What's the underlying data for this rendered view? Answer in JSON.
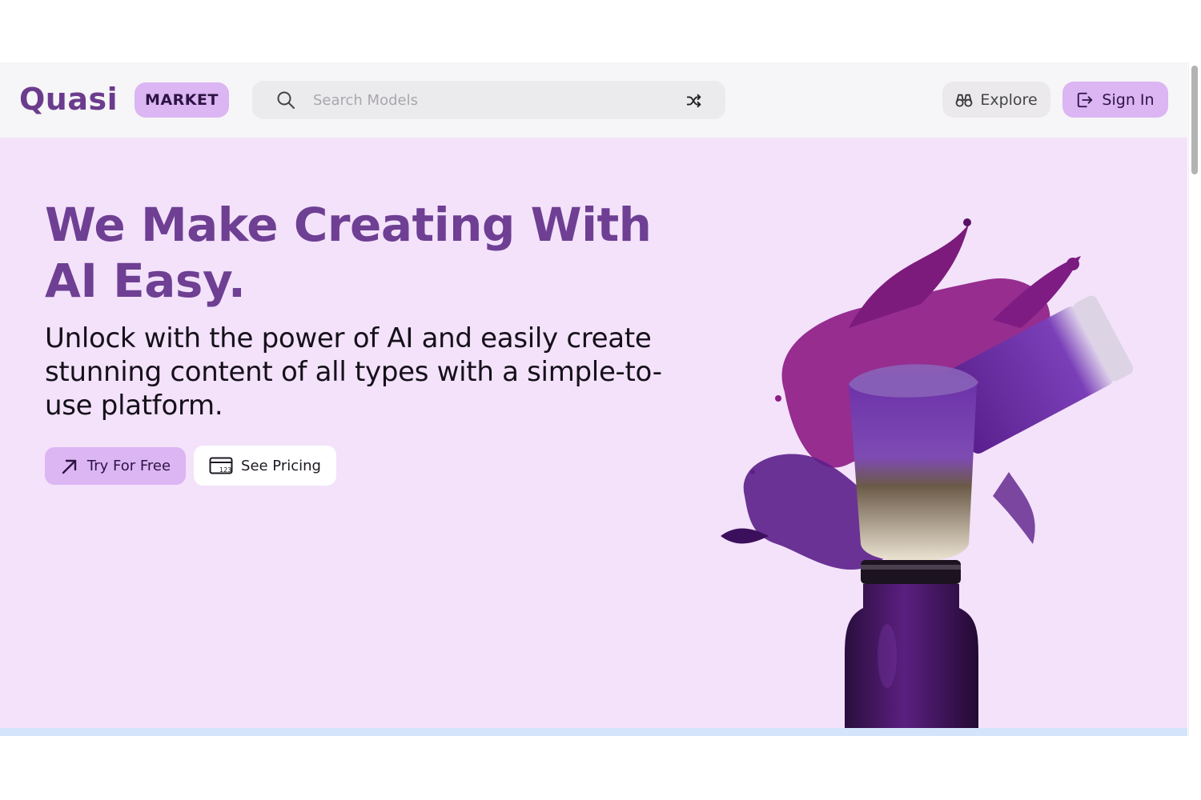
{
  "header": {
    "logo_text": "Quasi",
    "badge_label": "MARKET",
    "search": {
      "placeholder": "Search Models",
      "value": ""
    },
    "explore_label": "Explore",
    "signin_label": "Sign In"
  },
  "hero": {
    "title": "We Make Creating With AI Easy.",
    "subtitle": "Unlock with the power of AI and easily create stunning content of all types with a simple-to-use platform.",
    "primary_cta_label": "Try For Free",
    "secondary_cta_label": "See Pricing",
    "pricing_icon_text": "123"
  },
  "icons": {
    "search": "search-icon",
    "shuffle": "shuffle-icon",
    "explore": "binoculars-icon",
    "signin": "sign-in-icon",
    "try": "arrow-up-right-icon",
    "pricing": "price-tag-card-icon"
  },
  "colors": {
    "brand": "#6e3f93",
    "accent": "#dcb5f3",
    "hero_background": "#f3e2fa",
    "header_background": "#f6f5f7"
  }
}
